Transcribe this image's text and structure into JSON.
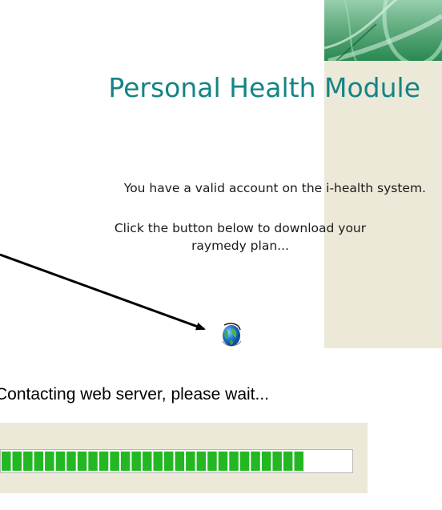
{
  "header": {
    "title": "Personal Health Module"
  },
  "message": {
    "line1": "You have a valid account on the i-health system.",
    "line2a": "Click the button below to download your",
    "line2b": "raymedy plan..."
  },
  "download_button": {
    "icon": "globe-icon"
  },
  "progress": {
    "status": "Contacting web server, please wait...",
    "fraction": 0.86,
    "fill_color": "#23b823",
    "segments": 28
  },
  "colors": {
    "accent": "#148486",
    "panel_bg": "#ece9d8"
  }
}
